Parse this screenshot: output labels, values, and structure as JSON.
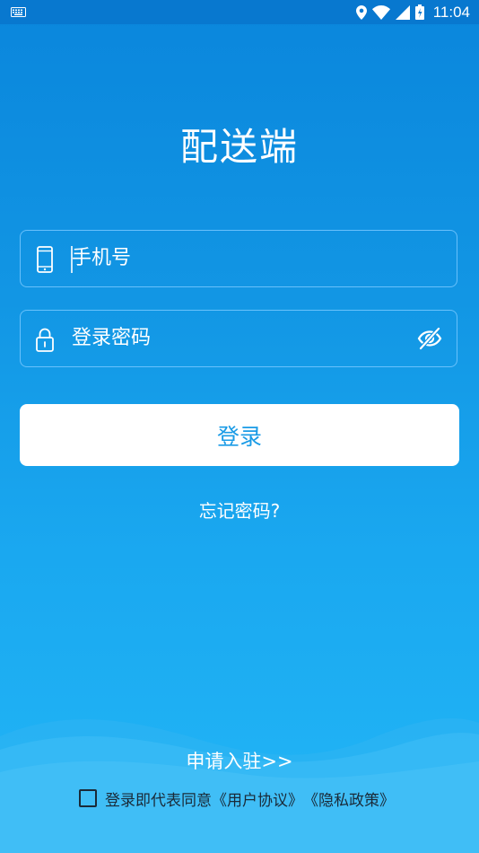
{
  "status_bar": {
    "time": "11:04",
    "icons": [
      "keyboard-icon",
      "location-icon",
      "wifi-icon",
      "signal-icon",
      "battery-icon"
    ]
  },
  "app": {
    "title": "配送端"
  },
  "form": {
    "phone_placeholder": "手机号",
    "password_placeholder": "登录密码",
    "login_label": "登录",
    "forgot_label": "忘记密码?"
  },
  "footer": {
    "apply_label": "申请入驻>>",
    "agreement_prefix": "登录即代表同意",
    "user_agreement": "《用户协议》",
    "privacy_policy": "《隐私政策》",
    "agreement_checked": false
  },
  "colors": {
    "accent": "#1a9be6",
    "background_top": "#0a86dc",
    "background_bottom": "#22b6f6"
  }
}
